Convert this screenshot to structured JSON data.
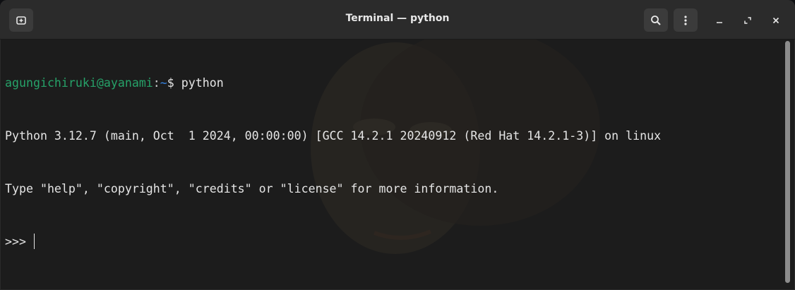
{
  "window": {
    "title": "Terminal — python"
  },
  "headerbar": {
    "new_tab_icon": "new-tab-icon",
    "search_icon": "search-icon",
    "menu_icon": "menu-icon",
    "minimize_icon": "minimize-icon",
    "maximize_icon": "maximize-icon",
    "close_icon": "close-icon"
  },
  "terminal": {
    "prompt": {
      "user_host": "agungichiruki@ayanami",
      "sep": ":",
      "path": "~",
      "symbol": "$ ",
      "command": "python"
    },
    "output": [
      "Python 3.12.7 (main, Oct  1 2024, 00:00:00) [GCC 14.2.1 20240912 (Red Hat 14.2.1-3)] on linux",
      "Type \"help\", \"copyright\", \"credits\" or \"license\" for more information."
    ],
    "repl_prompt": ">>> "
  },
  "colors": {
    "prompt_user": "#26a269",
    "prompt_path": "#3584e4",
    "background": "#1c1c1c",
    "headerbar": "#2b2b2b"
  }
}
